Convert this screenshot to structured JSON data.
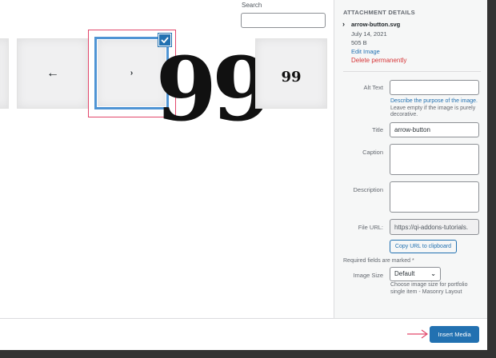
{
  "search": {
    "label": "Search",
    "value": ""
  },
  "grid": {
    "items": [
      {
        "name": "partial-item"
      },
      {
        "name": "left-arrow",
        "glyph": "←"
      },
      {
        "name": "arrow-button",
        "glyph": "›",
        "selected": true
      },
      {
        "name": "big-quote",
        "glyph": "99"
      },
      {
        "name": "small-quote",
        "glyph": "99"
      }
    ]
  },
  "details": {
    "heading": "ATTACHMENT DETAILS",
    "filename": "arrow-button.svg",
    "date": "July 14, 2021",
    "size": "505 B",
    "edit_link": "Edit Image",
    "delete_link": "Delete permanently"
  },
  "fields": {
    "alt_text": {
      "label": "Alt Text",
      "value": ""
    },
    "alt_help_link": "Describe the purpose of the image.",
    "alt_help_rest": " Leave empty if the image is purely decorative.",
    "title": {
      "label": "Title",
      "value": "arrow-button"
    },
    "caption": {
      "label": "Caption",
      "value": ""
    },
    "description": {
      "label": "Description",
      "value": ""
    },
    "file_url": {
      "label": "File URL:",
      "value": "https://qi-addons-tutorials."
    },
    "copy_button": "Copy URL to clipboard",
    "required_note": "Required fields are marked *",
    "image_size": {
      "label": "Image Size",
      "value": "Default",
      "help": "Choose image size for portfolio single item - Masonry Layout"
    }
  },
  "toolbar": {
    "insert_label": "Insert Media"
  },
  "colors": {
    "accent": "#2271b1",
    "delete": "#d63638",
    "highlight": "#e2476b"
  }
}
